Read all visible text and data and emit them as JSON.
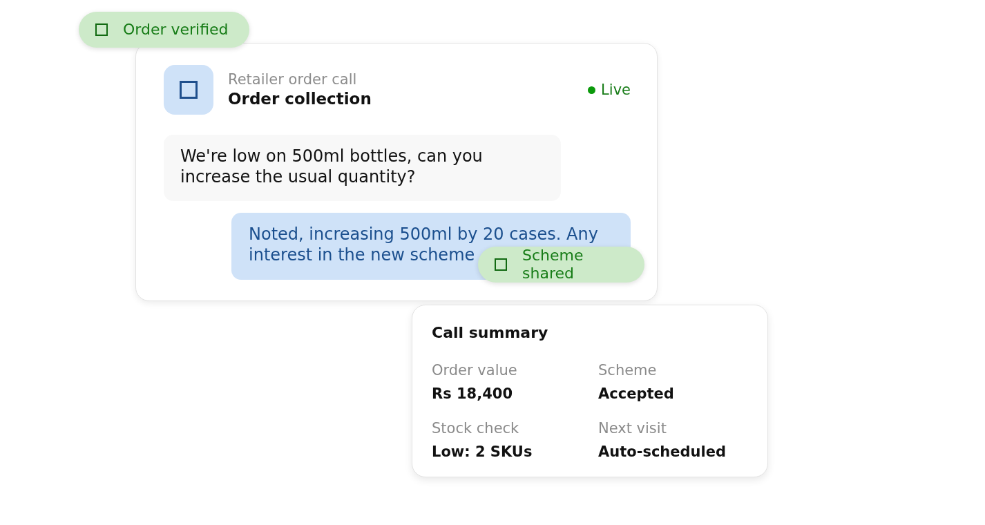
{
  "verification_badge": {
    "label": "Order verified"
  },
  "call_card": {
    "subtitle": "Retailer order call",
    "title": "Order collection",
    "status": {
      "label": "Live"
    },
    "messages": [
      {
        "kind": "incoming",
        "text": "We're low on 500ml bottles, can you increase the usual quantity?"
      },
      {
        "kind": "outgoing",
        "text": "Noted, increasing 500ml by 20 cases. Any interest in the new scheme"
      }
    ]
  },
  "shared_badge": {
    "label": "Scheme shared"
  },
  "summary": {
    "title": "Call summary",
    "fields": [
      {
        "label": "Order value",
        "value": "Rs 18,400"
      },
      {
        "label": "Scheme",
        "value": "Accepted"
      },
      {
        "label": "Stock check",
        "value": "Low: 2 SKUs"
      },
      {
        "label": "Next visit",
        "value": "Auto-scheduled"
      }
    ]
  }
}
